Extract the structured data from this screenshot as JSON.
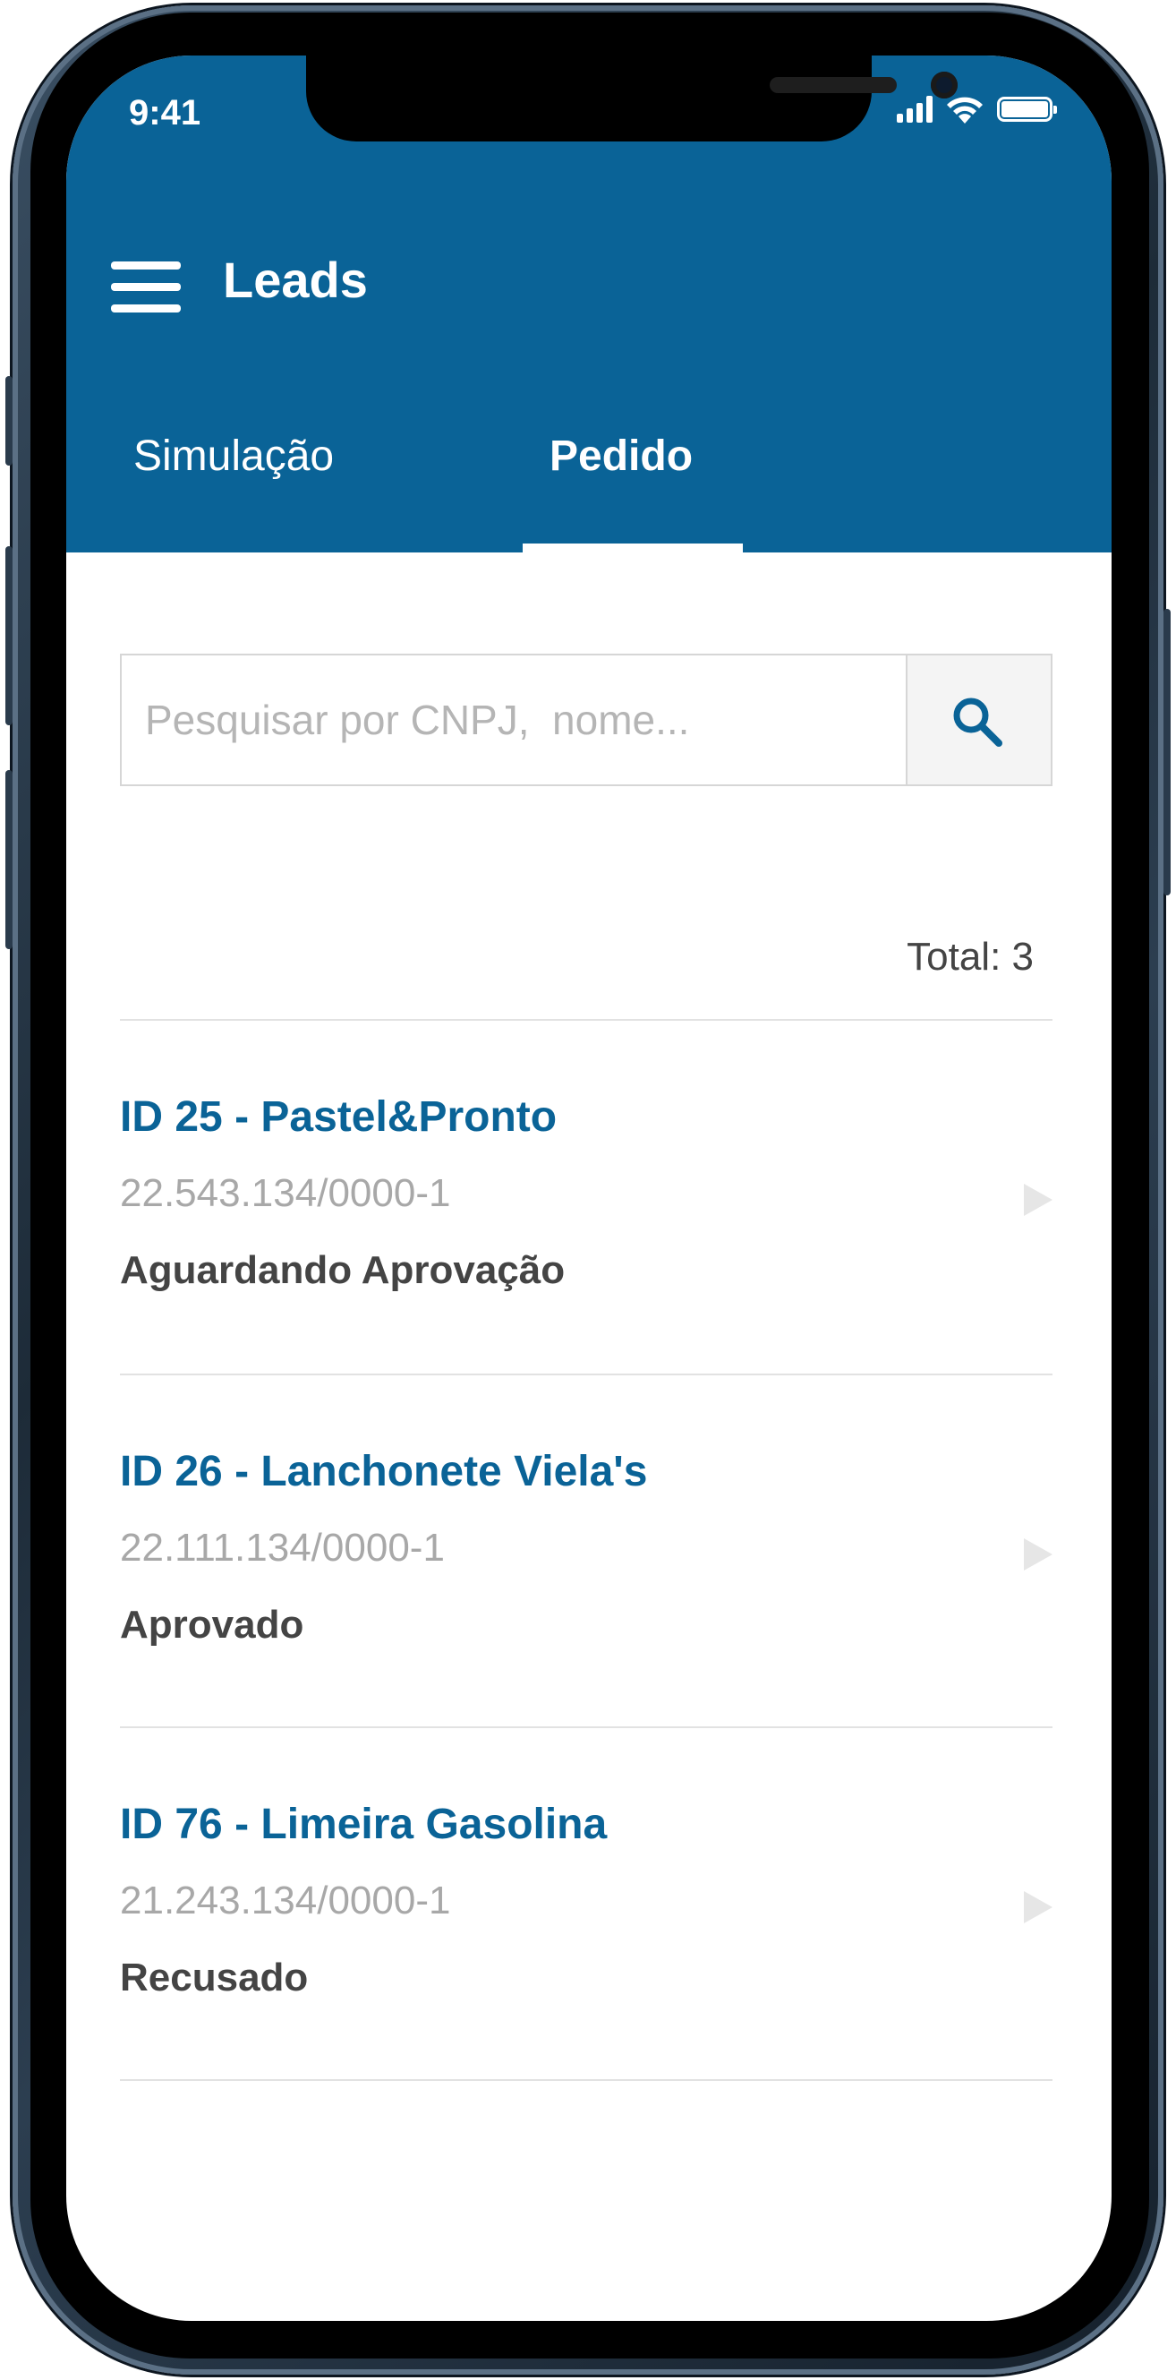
{
  "status_bar": {
    "time": "9:41"
  },
  "header": {
    "title": "Leads",
    "tabs": [
      {
        "label": "Simulação",
        "active": false
      },
      {
        "label": "Pedido",
        "active": true
      }
    ]
  },
  "search": {
    "placeholder": "Pesquisar por CNPJ,  nome..."
  },
  "total_label": "Total: 3",
  "leads": [
    {
      "title": "ID 25 - Pastel&Pronto",
      "document": "22.543.134/0000-1",
      "status": "Aguardando Aprovação"
    },
    {
      "title": "ID 26 - Lanchonete Viela's",
      "document": "22.111.134/0000-1",
      "status": "Aprovado"
    },
    {
      "title": "ID 76 - Limeira Gasolina",
      "document": "21.243.134/0000-1",
      "status": "Recusado"
    }
  ],
  "colors": {
    "primary": "#0a6397",
    "muted_text": "#a8a8a8",
    "body_text": "#444444"
  },
  "icons": [
    "menu-icon",
    "search-icon",
    "chevron-right-icon",
    "signal-icon",
    "wifi-icon",
    "battery-icon"
  ]
}
